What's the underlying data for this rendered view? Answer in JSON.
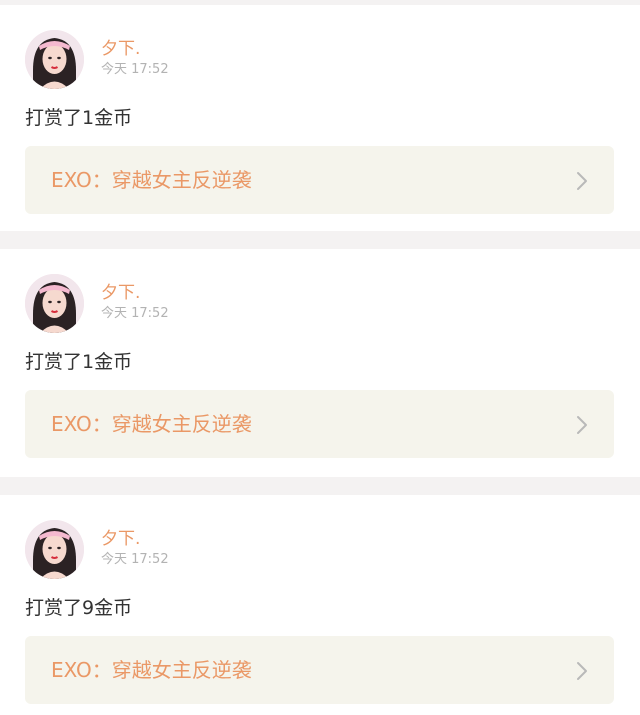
{
  "feed": {
    "items": [
      {
        "username": "夕下.",
        "time": "今天 17:52",
        "action": "打赏了1金币",
        "book_title": "EXO：穿越女主反逆袭",
        "avatar_icon": "user-avatar-photo",
        "chevron_icon": "chevron-right-icon"
      },
      {
        "username": "夕下.",
        "time": "今天 17:52",
        "action": "打赏了1金币",
        "book_title": "EXO：穿越女主反逆袭",
        "avatar_icon": "user-avatar-photo",
        "chevron_icon": "chevron-right-icon"
      },
      {
        "username": "夕下.",
        "time": "今天 17:52",
        "action": "打赏了9金币",
        "book_title": "EXO：穿越女主反逆袭",
        "avatar_icon": "user-avatar-photo",
        "chevron_icon": "chevron-right-icon"
      }
    ]
  },
  "colors": {
    "accent": "#ea9866",
    "background": "#f4f2f2",
    "card": "#ffffff",
    "link_box": "#f5f4ec",
    "muted_text": "#b3b3b3",
    "body_text": "#333333"
  }
}
